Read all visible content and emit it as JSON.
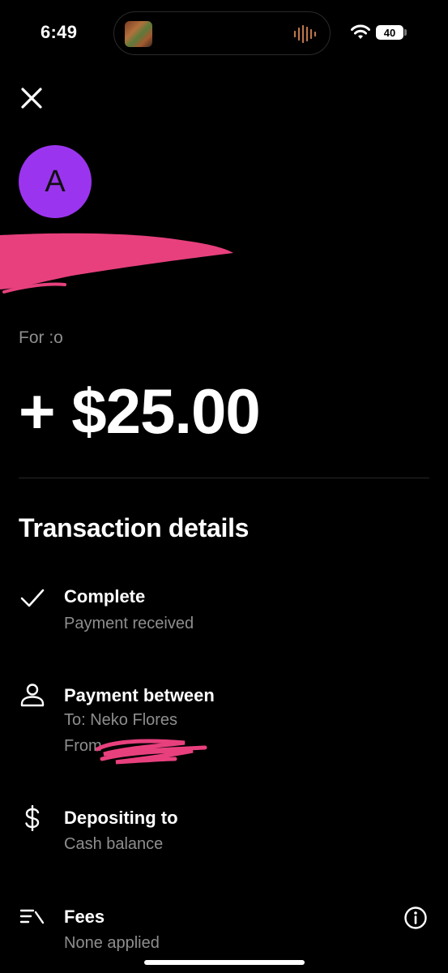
{
  "status_bar": {
    "time": "6:49",
    "battery": "40"
  },
  "header": {
    "avatar_initial": "A",
    "note": "For :o",
    "amount": "+ $25.00"
  },
  "details": {
    "title": "Transaction details",
    "status": {
      "title": "Complete",
      "subtitle": "Payment received",
      "icon": "checkmark-icon"
    },
    "between": {
      "title": "Payment between",
      "to": "To: Neko Flores",
      "from": "From",
      "icon": "person-icon"
    },
    "deposit": {
      "title": "Depositing to",
      "subtitle": "Cash balance",
      "icon": "dollar-icon"
    },
    "fees": {
      "title": "Fees",
      "subtitle": "None applied",
      "icon": "fees-list-icon"
    }
  },
  "colors": {
    "background": "#000000",
    "avatar": "#9B34EF",
    "secondary_text": "#8E8E8E",
    "redaction": "#E8407D"
  }
}
